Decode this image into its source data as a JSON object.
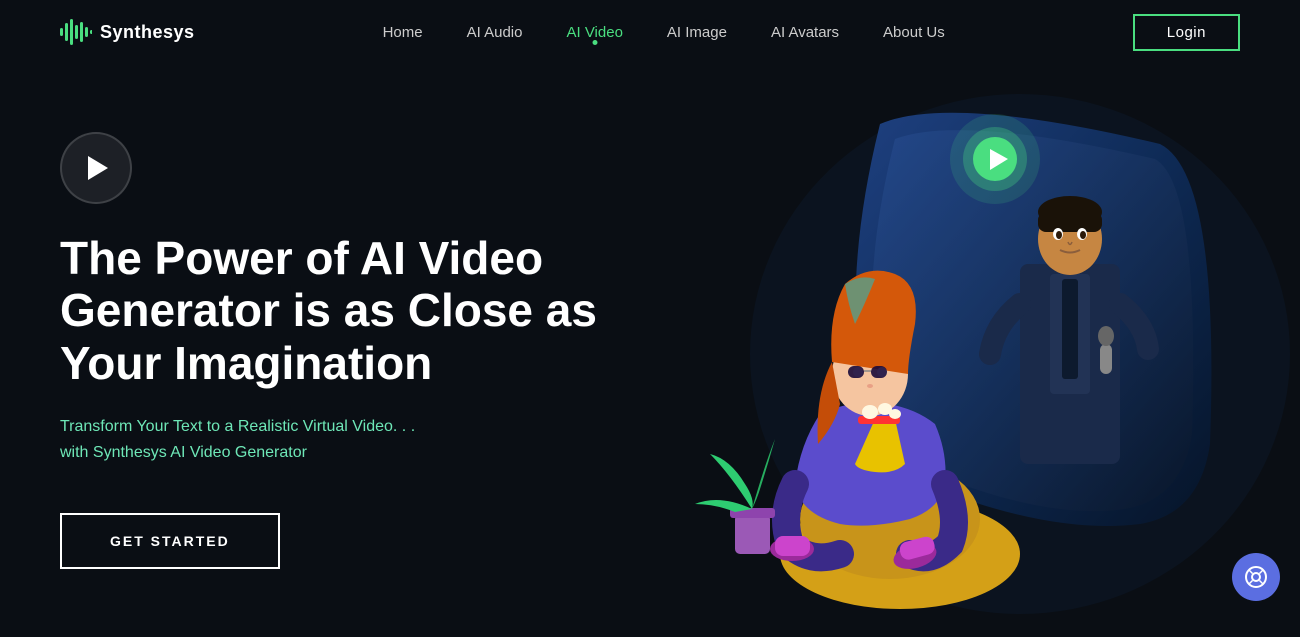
{
  "logo": {
    "text": "Synthesys"
  },
  "nav": {
    "links": [
      {
        "label": "Home",
        "active": false,
        "id": "home"
      },
      {
        "label": "AI Audio",
        "active": false,
        "id": "ai-audio"
      },
      {
        "label": "AI Video",
        "active": true,
        "id": "ai-video"
      },
      {
        "label": "AI Image",
        "active": false,
        "id": "ai-image"
      },
      {
        "label": "AI Avatars",
        "active": false,
        "id": "ai-avatars"
      },
      {
        "label": "About Us",
        "active": false,
        "id": "about-us"
      }
    ],
    "login_label": "Login"
  },
  "hero": {
    "title": "The Power of AI Video Generator is as Close as Your Imagination",
    "subtitle": "Transform Your Text to a Realistic Virtual Video. . .\nwith Synthesys AI Video Generator",
    "cta_label": "GET STARTED"
  },
  "help": {
    "icon": "life-ring"
  },
  "colors": {
    "accent": "#4ade80",
    "bg": "#0a0e14",
    "login_border": "#4ade80"
  }
}
